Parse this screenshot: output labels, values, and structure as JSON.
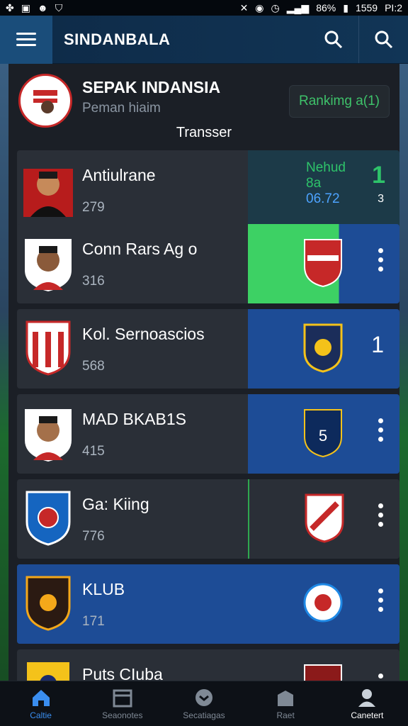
{
  "status_bar": {
    "left_icons": [
      "app-icon",
      "calendar-icon",
      "face-icon",
      "shield-icon"
    ],
    "battery": "86%",
    "time": "1559",
    "extra": "PI:2"
  },
  "app_bar": {
    "title": "SINDANBALA",
    "icons": [
      "search-icon",
      "search-icon"
    ]
  },
  "team": {
    "name": "SEPAK INDANSIA",
    "subtitle": "Peman hiaim",
    "ranking_label": "Rankimg a(1)",
    "transfer_label": "Transser"
  },
  "rows": [
    {
      "name": "Antiulrane",
      "score": "279",
      "extra_title": "Nehud",
      "extra_sub": "8a",
      "extra_value": "06.72",
      "rank": "1",
      "small": "3",
      "right_style": "teal",
      "avatar": "player-avatar"
    },
    {
      "name": "Conn Rars Ag o",
      "score": "316",
      "right_style": "green",
      "crest_color": "#c62828",
      "kebab": true,
      "avatar": "player-avatar"
    },
    {
      "name": "Kol. Sernoascios",
      "score": "568",
      "right_style": "blue",
      "crest_color": "#f4c21a",
      "rank": "1",
      "avatar": "club-crest"
    },
    {
      "name": "MAD BKAB1S",
      "score": "415",
      "right_style": "blue",
      "crest_color": "#1565c0",
      "kebab": true,
      "avatar": "player-avatar"
    },
    {
      "name": "Ga: Kiing",
      "score": "776",
      "right_style": "dark",
      "crest_color": "#c62828",
      "kebab": true,
      "avatar": "club-crest"
    },
    {
      "name": "KLUB",
      "score": "171",
      "right_style": "blue",
      "crest_color": "#1e88e5",
      "kebab": true,
      "avatar": "club-crest",
      "row_blue": true
    },
    {
      "name": "Puts CIuba",
      "score": "",
      "right_style": "dark",
      "crest_color": "#8b1a1a",
      "kebab": true,
      "avatar": "club-crest"
    }
  ],
  "bottom_nav": [
    {
      "label": "Caltie",
      "icon": "home-icon",
      "active": true
    },
    {
      "label": "Seaonotes",
      "icon": "calendar-icon"
    },
    {
      "label": "Secatiagas",
      "icon": "ball-icon"
    },
    {
      "label": "Raet",
      "icon": "trophy-icon"
    },
    {
      "label": "Canetert",
      "icon": "profile-icon",
      "strong": true
    }
  ],
  "colors": {
    "accent_blue": "#1d4c96",
    "accent_green": "#3dd164",
    "ranking_green": "#3ec26a"
  }
}
